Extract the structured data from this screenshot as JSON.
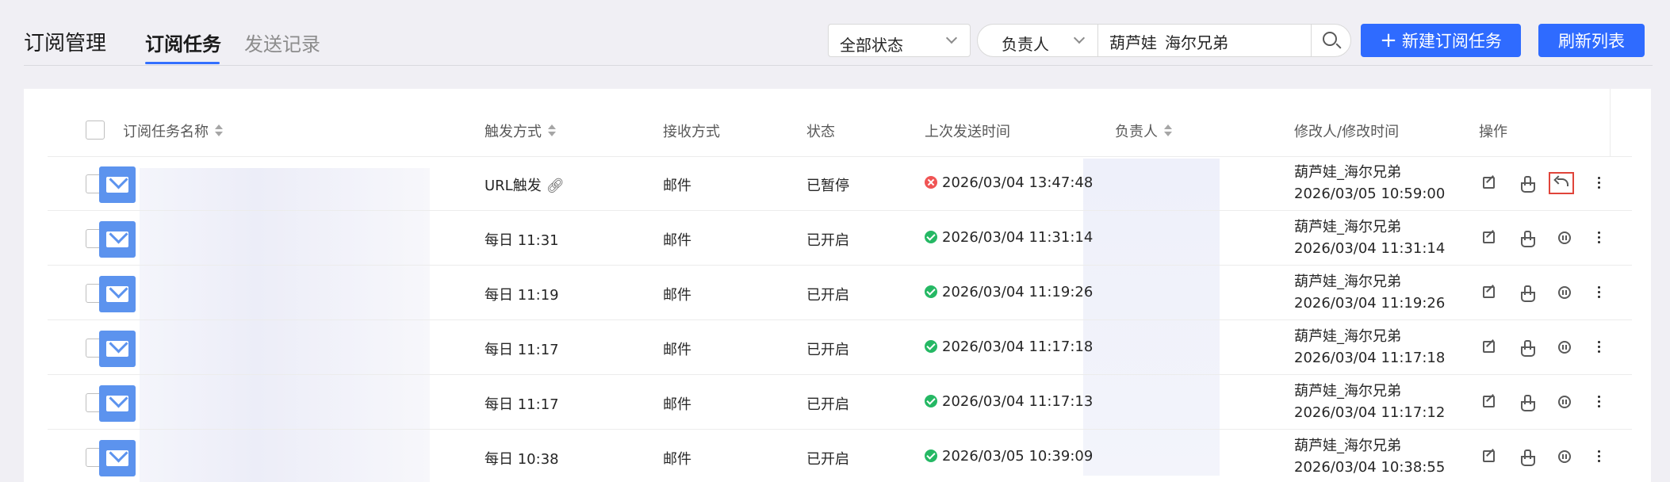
{
  "header": {
    "title": "订阅管理",
    "tabs": [
      {
        "label": "订阅任务",
        "active": true
      },
      {
        "label": "发送记录",
        "active": false
      }
    ]
  },
  "filters": {
    "status_select": "全部状态",
    "owner_select": "负责人",
    "owner_value": "葫芦娃_海尔兄弟"
  },
  "actions": {
    "new_task": "新建订阅任务",
    "refresh": "刷新列表"
  },
  "table": {
    "columns": {
      "name": "订阅任务名称",
      "trigger": "触发方式",
      "receive": "接收方式",
      "status": "状态",
      "last_sent": "上次发送时间",
      "owner": "负责人",
      "modifier": "修改人/修改时间",
      "ops": "操作"
    },
    "rows": [
      {
        "trigger": "URL触发",
        "receive": "邮件",
        "status": "已暂停",
        "last_sent": "2026/03/04 13:47:48",
        "sent_ok": false,
        "modifier": "葫芦娃_海尔兄弟",
        "modified_at": "2026/03/05 10:59:00",
        "paused": true
      },
      {
        "trigger": "每日 11:31",
        "receive": "邮件",
        "status": "已开启",
        "last_sent": "2026/03/04 11:31:14",
        "sent_ok": true,
        "modifier": "葫芦娃_海尔兄弟",
        "modified_at": "2026/03/04 11:31:14",
        "paused": false
      },
      {
        "trigger": "每日 11:19",
        "receive": "邮件",
        "status": "已开启",
        "last_sent": "2026/03/04 11:19:26",
        "sent_ok": true,
        "modifier": "葫芦娃_海尔兄弟",
        "modified_at": "2026/03/04 11:19:26",
        "paused": false
      },
      {
        "trigger": "每日 11:17",
        "receive": "邮件",
        "status": "已开启",
        "last_sent": "2026/03/04 11:17:18",
        "sent_ok": true,
        "modifier": "葫芦娃_海尔兄弟",
        "modified_at": "2026/03/04 11:17:18",
        "paused": false
      },
      {
        "trigger": "每日 11:17",
        "receive": "邮件",
        "status": "已开启",
        "last_sent": "2026/03/04 11:17:13",
        "sent_ok": true,
        "modifier": "葫芦娃_海尔兄弟",
        "modified_at": "2026/03/04 11:17:12",
        "paused": false
      },
      {
        "trigger": "每日 10:38",
        "receive": "邮件",
        "status": "已开启",
        "last_sent": "2026/03/05 10:39:09",
        "sent_ok": true,
        "modifier": "葫芦娃_海尔兄弟",
        "modified_at": "2026/03/04 10:38:55",
        "paused": false
      }
    ]
  },
  "colors": {
    "primary": "#2f6bff",
    "success": "#25b864",
    "error": "#f05454",
    "highlight": "#e0443a"
  }
}
